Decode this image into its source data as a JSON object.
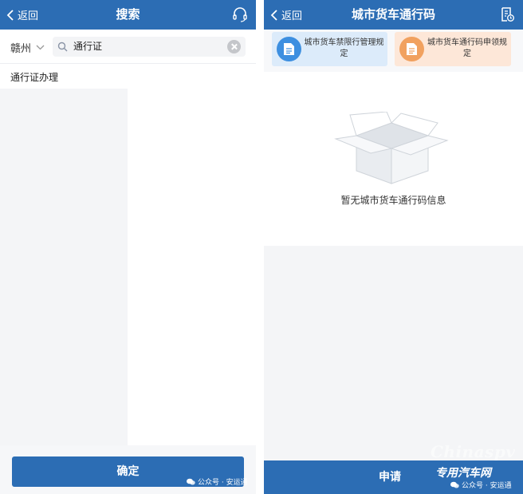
{
  "colors": {
    "primary": "#2c6db4",
    "card_blue": "#dcebfa",
    "card_orange": "#fde7d8"
  },
  "left": {
    "header": {
      "back_label": "返回",
      "title": "搜索",
      "service_icon": "headset-icon"
    },
    "search": {
      "city": "赣州",
      "query": "通行证"
    },
    "suggestions": [
      "通行证办理"
    ],
    "confirm_label": "确定",
    "watermark": "公众号 · 安运通"
  },
  "right": {
    "header": {
      "back_label": "返回",
      "title": "城市货车通行码",
      "history_icon": "document-history-icon"
    },
    "cards": [
      {
        "label": "城市货车禁限行管理规定",
        "icon": "document-icon"
      },
      {
        "label": "城市货车通行码申领规定",
        "icon": "document-icon"
      }
    ],
    "empty_text": "暂无城市货车通行码信息",
    "apply_label": "申请",
    "brand_en": "Chinaspv",
    "brand_cn": "专用汽车网",
    "watermark": "公众号 · 安运通"
  }
}
